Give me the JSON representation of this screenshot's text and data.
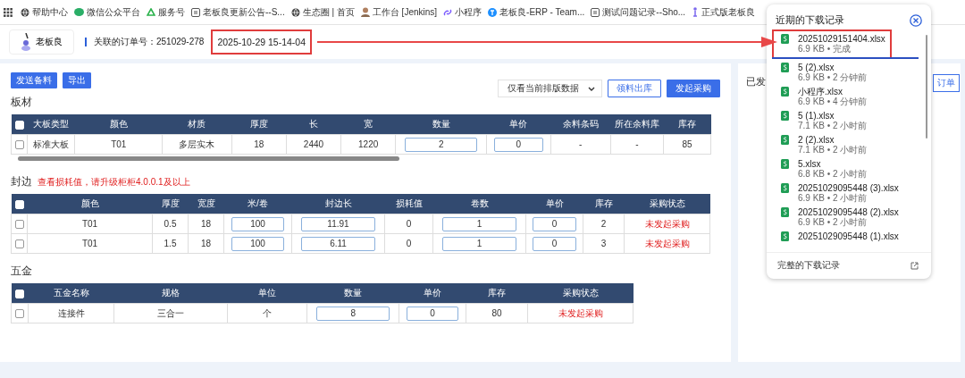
{
  "bookmarks": [
    {
      "label": "帮助中心"
    },
    {
      "label": "微信公众平台"
    },
    {
      "label": "服务号"
    },
    {
      "label": "老板良更新公告--S..."
    },
    {
      "label": "生态圈 | 首页"
    },
    {
      "label": "工作台 [Jenkins]"
    },
    {
      "label": "小程序"
    },
    {
      "label": "老板良-ERP - Team..."
    },
    {
      "label": "测试问题记录--Sho..."
    },
    {
      "label": "正式版老板良"
    }
  ],
  "header": {
    "logo_text": "老板良",
    "order_label": "关联的订单号：251029-278",
    "timestamp": "2025-10-29 15-14-04"
  },
  "toolbar": {
    "buttons": [
      "发送备料",
      "导出"
    ],
    "filter": "仅看当前排版数据",
    "actions": [
      {
        "label": "领料出库",
        "kind": "outline"
      },
      {
        "label": "发起采购",
        "kind": "primary"
      }
    ]
  },
  "boards": {
    "title": "板材",
    "header_checked": false,
    "columns": [
      "大板类型",
      "颜色",
      "材质",
      "厚度",
      "长",
      "宽",
      "数量",
      "单价",
      "余料条码",
      "所在余料库",
      "库存"
    ],
    "rows": [
      {
        "checked": false,
        "cells": [
          "标准大板",
          "T01",
          "多层实木",
          "18",
          "2440",
          "1220",
          "2",
          "0",
          "-",
          "-",
          "85"
        ]
      }
    ]
  },
  "edge": {
    "title": "封边",
    "notice": "查看损耗值，请升级柜柜4.0.0.1及以上",
    "header_checked": false,
    "columns": [
      "颜色",
      "厚度",
      "宽度",
      "米/卷",
      "封边长",
      "损耗值",
      "卷数",
      "单价",
      "库存",
      "采购状态"
    ],
    "rows": [
      {
        "checked": false,
        "cells": [
          "T01",
          "0.5",
          "18",
          "100",
          "11.91",
          "0",
          "1",
          "0",
          "2",
          "未发起采购"
        ]
      },
      {
        "checked": false,
        "cells": [
          "T01",
          "1.5",
          "18",
          "100",
          "6.11",
          "0",
          "1",
          "0",
          "3",
          "未发起采购"
        ]
      }
    ]
  },
  "hardware": {
    "title": "五金",
    "header_checked": false,
    "columns": [
      "五金名称",
      "规格",
      "单位",
      "数量",
      "单价",
      "库存",
      "采购状态"
    ],
    "rows": [
      {
        "checked": false,
        "cells": [
          "连接件",
          "三合一",
          "个",
          "8",
          "0",
          "80",
          "未发起采购"
        ]
      }
    ]
  },
  "side_panel": {
    "title": "已发",
    "button": "订单"
  },
  "downloads": {
    "title": "近期的下载记录",
    "items": [
      {
        "name": "20251029151404.xlsx",
        "meta": "6.9 KB • 完成",
        "level": 1,
        "highlighted": true
      },
      {
        "name": "5 (2).xlsx",
        "meta": "6.9 KB • 2 分钟前",
        "highlighted": false
      },
      {
        "name": "小程序.xlsx",
        "meta": "6.9 KB • 4 分钟前",
        "highlighted": false
      },
      {
        "name": "5 (1).xlsx",
        "meta": "7.1 KB • 2 小时前",
        "highlighted": false
      },
      {
        "name": "2 (2).xlsx",
        "meta": "7.1 KB • 2 小时前",
        "highlighted": false
      },
      {
        "name": "5.xlsx",
        "meta": "6.8 KB • 2 小时前",
        "highlighted": false
      },
      {
        "name": "20251029095448 (3).xlsx",
        "meta": "6.9 KB • 2 小时前",
        "highlighted": false
      },
      {
        "name": "20251029095448 (2).xlsx",
        "meta": "6.9 KB • 2 小时前",
        "highlighted": false
      },
      {
        "name": "20251029095448 (1).xlsx",
        "highlighted": false
      }
    ],
    "footer": "完整的下载记录"
  }
}
